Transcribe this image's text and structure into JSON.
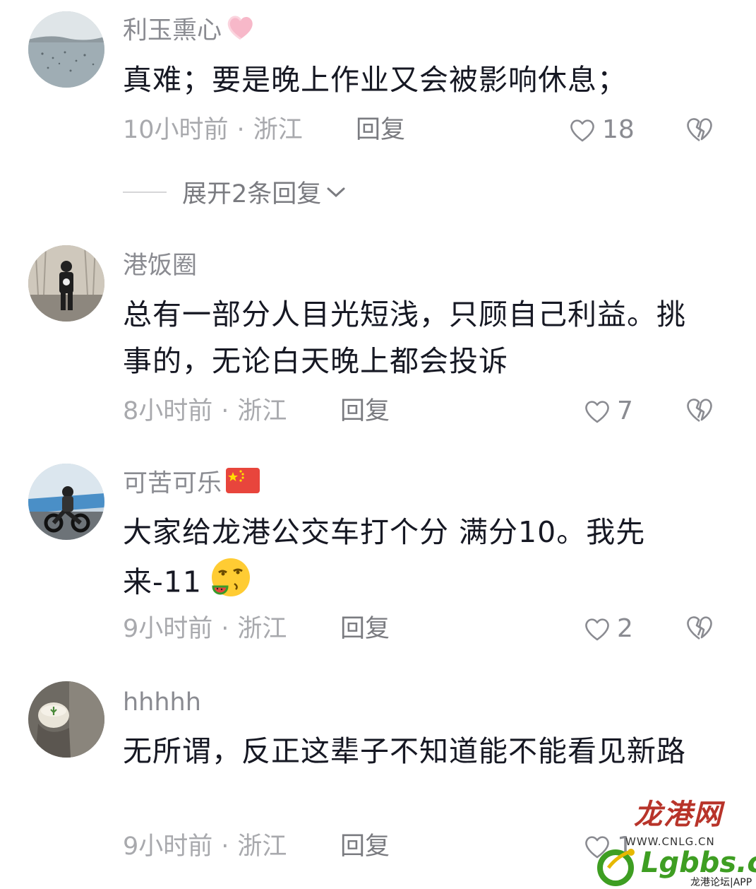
{
  "comments": [
    {
      "username": "利玉熏心",
      "text": "真难；要是晚上作业又会被影响休息；",
      "time": "10小时前",
      "location": "浙江",
      "reply_label": "回复",
      "likes": "18",
      "expand_label": "展开2条回复"
    },
    {
      "username": "港饭圈",
      "text": "总有一部分人目光短浅，只顾自己利益。挑事的，无论白天晚上都会投诉",
      "time": "8小时前",
      "location": "浙江",
      "reply_label": "回复",
      "likes": "7"
    },
    {
      "username": "可苦可乐",
      "text": "大家给龙港公交车打个分 满分10。我先来-11",
      "time": "9小时前",
      "location": "浙江",
      "reply_label": "回复",
      "likes": "2"
    },
    {
      "username": "hhhhh",
      "text": "无所谓，反正这辈子不知道能不能看见新路",
      "time": "9小时前",
      "location": "浙江",
      "reply_label": "回复",
      "likes": "1"
    }
  ],
  "separator": "·",
  "watermark": {
    "title": "龙港网",
    "url": "WWW.CNLG.CN",
    "logo": "Lgbbs.cn",
    "subtitle": "龙港论坛|APP"
  },
  "colors": {
    "name": "#8a8b91",
    "meta": "#a8a9ad",
    "text": "#161823",
    "flag_red": "#e8453c",
    "heart_pink": "#f7b8c9"
  },
  "icons": [
    "heart-icon",
    "broken-heart-icon",
    "chevron-down-icon",
    "pink-heart-badge",
    "china-flag-badge",
    "watermelon-emoji"
  ]
}
